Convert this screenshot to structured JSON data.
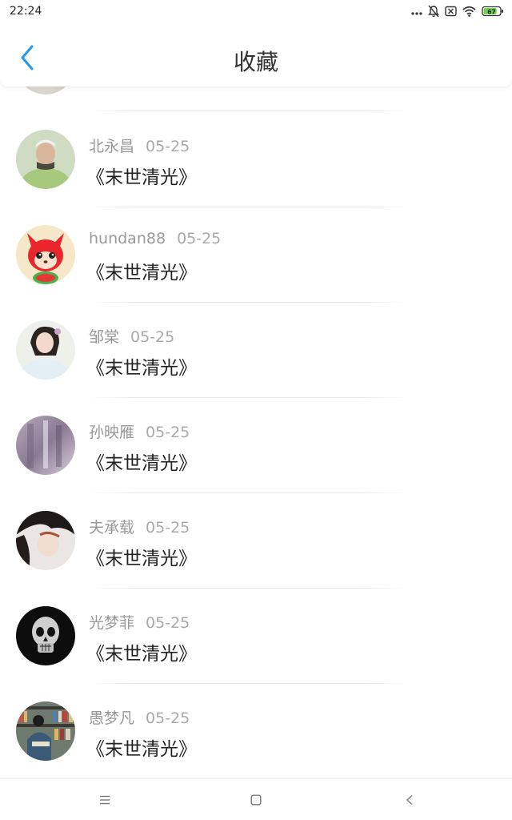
{
  "status_bar": {
    "time": "22:24",
    "battery": "67",
    "icons": [
      "more-dots-icon",
      "bell-muted-icon",
      "sim-off-icon",
      "wifi-icon",
      "battery-icon"
    ]
  },
  "header": {
    "title": "收藏",
    "back_icon": "chevron-left-icon",
    "accent_color": "#2196F3"
  },
  "favorites": [
    {
      "user": "北永昌",
      "date": "05-25",
      "title": "《末世清光》",
      "avatar": "avatar-girl-green"
    },
    {
      "user": "hundan88",
      "date": "05-25",
      "title": "《末世清光》",
      "avatar": "avatar-red-fox-cartoon"
    },
    {
      "user": "邹棠",
      "date": "05-25",
      "title": "《末世清光》",
      "avatar": "avatar-girl-hanfu"
    },
    {
      "user": "孙映雁",
      "date": "05-25",
      "title": "《末世清光》",
      "avatar": "avatar-purple-blur"
    },
    {
      "user": "夫承载",
      "date": "05-25",
      "title": "《末世清光》",
      "avatar": "avatar-girl-dark-hair"
    },
    {
      "user": "光梦菲",
      "date": "05-25",
      "title": "《末世清光》",
      "avatar": "avatar-skull"
    },
    {
      "user": "愚梦凡",
      "date": "05-25",
      "title": "《末世清光》",
      "avatar": "avatar-person-bookshelf"
    }
  ],
  "nav_bar": {
    "icons": [
      "menu-icon",
      "home-square-icon",
      "back-triangle-icon"
    ]
  }
}
